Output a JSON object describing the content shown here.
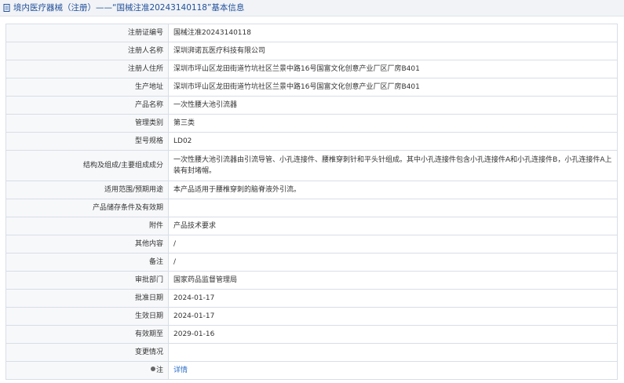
{
  "header": {
    "title": "境内医疗器械（注册）——“国械注准20243140118”基本信息"
  },
  "rows": [
    {
      "label": "注册证编号",
      "value": "国械注准20243140118"
    },
    {
      "label": "注册人名称",
      "value": "深圳湃诺瓦医疗科技有限公司"
    },
    {
      "label": "注册人住所",
      "value": "深圳市坪山区龙田街道竹坑社区兰景中路16号国富文化创意产业厂区厂房B401"
    },
    {
      "label": "生产地址",
      "value": "深圳市坪山区龙田街道竹坑社区兰景中路16号国富文化创意产业厂区厂房B401"
    },
    {
      "label": "产品名称",
      "value": "一次性腰大池引流器"
    },
    {
      "label": "管理类别",
      "value": "第三类"
    },
    {
      "label": "型号规格",
      "value": "LD02"
    },
    {
      "label": "结构及组成/主要组成成分",
      "value": "一次性腰大池引流器由引流导管、小孔连接件、腰椎穿刺针和平头针组成。其中小孔连接件包含小孔连接件A和小孔连接件B，小孔连接件A上装有封堵帽。"
    },
    {
      "label": "适用范围/预期用途",
      "value": "本产品适用于腰椎穿刺的脑脊液外引流。"
    },
    {
      "label": "产品储存条件及有效期",
      "value": ""
    },
    {
      "label": "附件",
      "value": "产品技术要求"
    },
    {
      "label": "其他内容",
      "value": "/"
    },
    {
      "label": "备注",
      "value": "/"
    },
    {
      "label": "审批部门",
      "value": "国家药品监督管理局"
    },
    {
      "label": "批准日期",
      "value": "2024-01-17"
    },
    {
      "label": "生效日期",
      "value": "2024-01-17"
    },
    {
      "label": "有效期至",
      "value": "2029-01-16"
    },
    {
      "label": "变更情况",
      "value": ""
    },
    {
      "label": "注",
      "value": "详情"
    }
  ]
}
